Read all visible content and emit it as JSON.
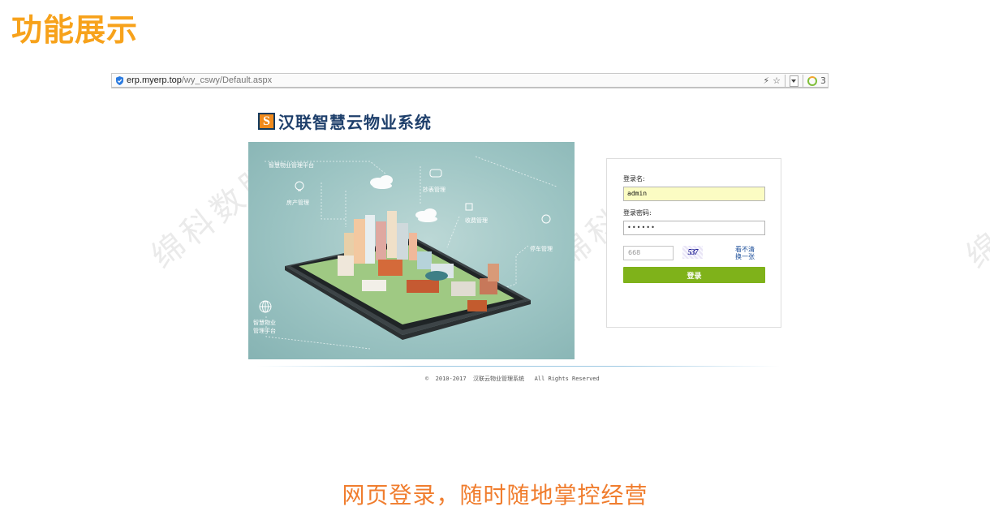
{
  "slide": {
    "title": "功能展示",
    "caption": "网页登录，随时随地掌控经营",
    "watermark": "绵科数服",
    "watermark_edge": "绵科"
  },
  "browser": {
    "url_host": "erp.myerp.top",
    "url_path": "/wy_cswy/Default.aspx",
    "icons": [
      "bolt-icon",
      "star-icon",
      "dropdown-icon",
      "extension-ring-icon"
    ],
    "extension_count": "3"
  },
  "app": {
    "logo_mark": "S",
    "name": "汉联智慧云物业系统",
    "brand_color": "#f08a1c"
  },
  "hero": {
    "labels": {
      "platform": "智慧物业管理平台",
      "property": "房产管理",
      "meter": "抄表管理",
      "fees": "收费管理",
      "parking": "停车管理",
      "platform_bottom_1": "智慧物业",
      "platform_bottom_2": "管理平台"
    }
  },
  "login": {
    "username_label": "登录名:",
    "username_value": "admin",
    "password_label": "登录密码:",
    "password_value": "••••••",
    "captcha_placeholder": "668",
    "captcha_code": "537",
    "refresh_line1": "看不清",
    "refresh_line2": "换一张",
    "submit_label": "登录",
    "button_color": "#7fb21a"
  },
  "footer": {
    "copyright": "©  2010-2017  汉联云物业管理系统   All Rights Reserved"
  },
  "colors": {
    "title": "#f7a21b",
    "caption": "#f07d2e"
  }
}
